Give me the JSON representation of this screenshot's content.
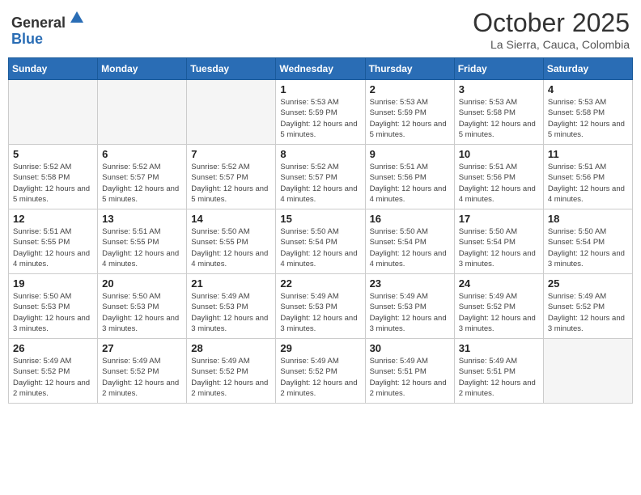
{
  "logo": {
    "line1": "General",
    "line2": "Blue"
  },
  "title": "October 2025",
  "location": "La Sierra, Cauca, Colombia",
  "days_of_week": [
    "Sunday",
    "Monday",
    "Tuesday",
    "Wednesday",
    "Thursday",
    "Friday",
    "Saturday"
  ],
  "weeks": [
    [
      {
        "day": "",
        "empty": true
      },
      {
        "day": "",
        "empty": true
      },
      {
        "day": "",
        "empty": true
      },
      {
        "day": "1",
        "sunrise": "5:53 AM",
        "sunset": "5:59 PM",
        "daylight": "12 hours and 5 minutes."
      },
      {
        "day": "2",
        "sunrise": "5:53 AM",
        "sunset": "5:59 PM",
        "daylight": "12 hours and 5 minutes."
      },
      {
        "day": "3",
        "sunrise": "5:53 AM",
        "sunset": "5:58 PM",
        "daylight": "12 hours and 5 minutes."
      },
      {
        "day": "4",
        "sunrise": "5:53 AM",
        "sunset": "5:58 PM",
        "daylight": "12 hours and 5 minutes."
      }
    ],
    [
      {
        "day": "5",
        "sunrise": "5:52 AM",
        "sunset": "5:58 PM",
        "daylight": "12 hours and 5 minutes."
      },
      {
        "day": "6",
        "sunrise": "5:52 AM",
        "sunset": "5:57 PM",
        "daylight": "12 hours and 5 minutes."
      },
      {
        "day": "7",
        "sunrise": "5:52 AM",
        "sunset": "5:57 PM",
        "daylight": "12 hours and 5 minutes."
      },
      {
        "day": "8",
        "sunrise": "5:52 AM",
        "sunset": "5:57 PM",
        "daylight": "12 hours and 4 minutes."
      },
      {
        "day": "9",
        "sunrise": "5:51 AM",
        "sunset": "5:56 PM",
        "daylight": "12 hours and 4 minutes."
      },
      {
        "day": "10",
        "sunrise": "5:51 AM",
        "sunset": "5:56 PM",
        "daylight": "12 hours and 4 minutes."
      },
      {
        "day": "11",
        "sunrise": "5:51 AM",
        "sunset": "5:56 PM",
        "daylight": "12 hours and 4 minutes."
      }
    ],
    [
      {
        "day": "12",
        "sunrise": "5:51 AM",
        "sunset": "5:55 PM",
        "daylight": "12 hours and 4 minutes."
      },
      {
        "day": "13",
        "sunrise": "5:51 AM",
        "sunset": "5:55 PM",
        "daylight": "12 hours and 4 minutes."
      },
      {
        "day": "14",
        "sunrise": "5:50 AM",
        "sunset": "5:55 PM",
        "daylight": "12 hours and 4 minutes."
      },
      {
        "day": "15",
        "sunrise": "5:50 AM",
        "sunset": "5:54 PM",
        "daylight": "12 hours and 4 minutes."
      },
      {
        "day": "16",
        "sunrise": "5:50 AM",
        "sunset": "5:54 PM",
        "daylight": "12 hours and 4 minutes."
      },
      {
        "day": "17",
        "sunrise": "5:50 AM",
        "sunset": "5:54 PM",
        "daylight": "12 hours and 3 minutes."
      },
      {
        "day": "18",
        "sunrise": "5:50 AM",
        "sunset": "5:54 PM",
        "daylight": "12 hours and 3 minutes."
      }
    ],
    [
      {
        "day": "19",
        "sunrise": "5:50 AM",
        "sunset": "5:53 PM",
        "daylight": "12 hours and 3 minutes."
      },
      {
        "day": "20",
        "sunrise": "5:50 AM",
        "sunset": "5:53 PM",
        "daylight": "12 hours and 3 minutes."
      },
      {
        "day": "21",
        "sunrise": "5:49 AM",
        "sunset": "5:53 PM",
        "daylight": "12 hours and 3 minutes."
      },
      {
        "day": "22",
        "sunrise": "5:49 AM",
        "sunset": "5:53 PM",
        "daylight": "12 hours and 3 minutes."
      },
      {
        "day": "23",
        "sunrise": "5:49 AM",
        "sunset": "5:53 PM",
        "daylight": "12 hours and 3 minutes."
      },
      {
        "day": "24",
        "sunrise": "5:49 AM",
        "sunset": "5:52 PM",
        "daylight": "12 hours and 3 minutes."
      },
      {
        "day": "25",
        "sunrise": "5:49 AM",
        "sunset": "5:52 PM",
        "daylight": "12 hours and 3 minutes."
      }
    ],
    [
      {
        "day": "26",
        "sunrise": "5:49 AM",
        "sunset": "5:52 PM",
        "daylight": "12 hours and 2 minutes."
      },
      {
        "day": "27",
        "sunrise": "5:49 AM",
        "sunset": "5:52 PM",
        "daylight": "12 hours and 2 minutes."
      },
      {
        "day": "28",
        "sunrise": "5:49 AM",
        "sunset": "5:52 PM",
        "daylight": "12 hours and 2 minutes."
      },
      {
        "day": "29",
        "sunrise": "5:49 AM",
        "sunset": "5:52 PM",
        "daylight": "12 hours and 2 minutes."
      },
      {
        "day": "30",
        "sunrise": "5:49 AM",
        "sunset": "5:51 PM",
        "daylight": "12 hours and 2 minutes."
      },
      {
        "day": "31",
        "sunrise": "5:49 AM",
        "sunset": "5:51 PM",
        "daylight": "12 hours and 2 minutes."
      },
      {
        "day": "",
        "empty": true
      }
    ]
  ]
}
